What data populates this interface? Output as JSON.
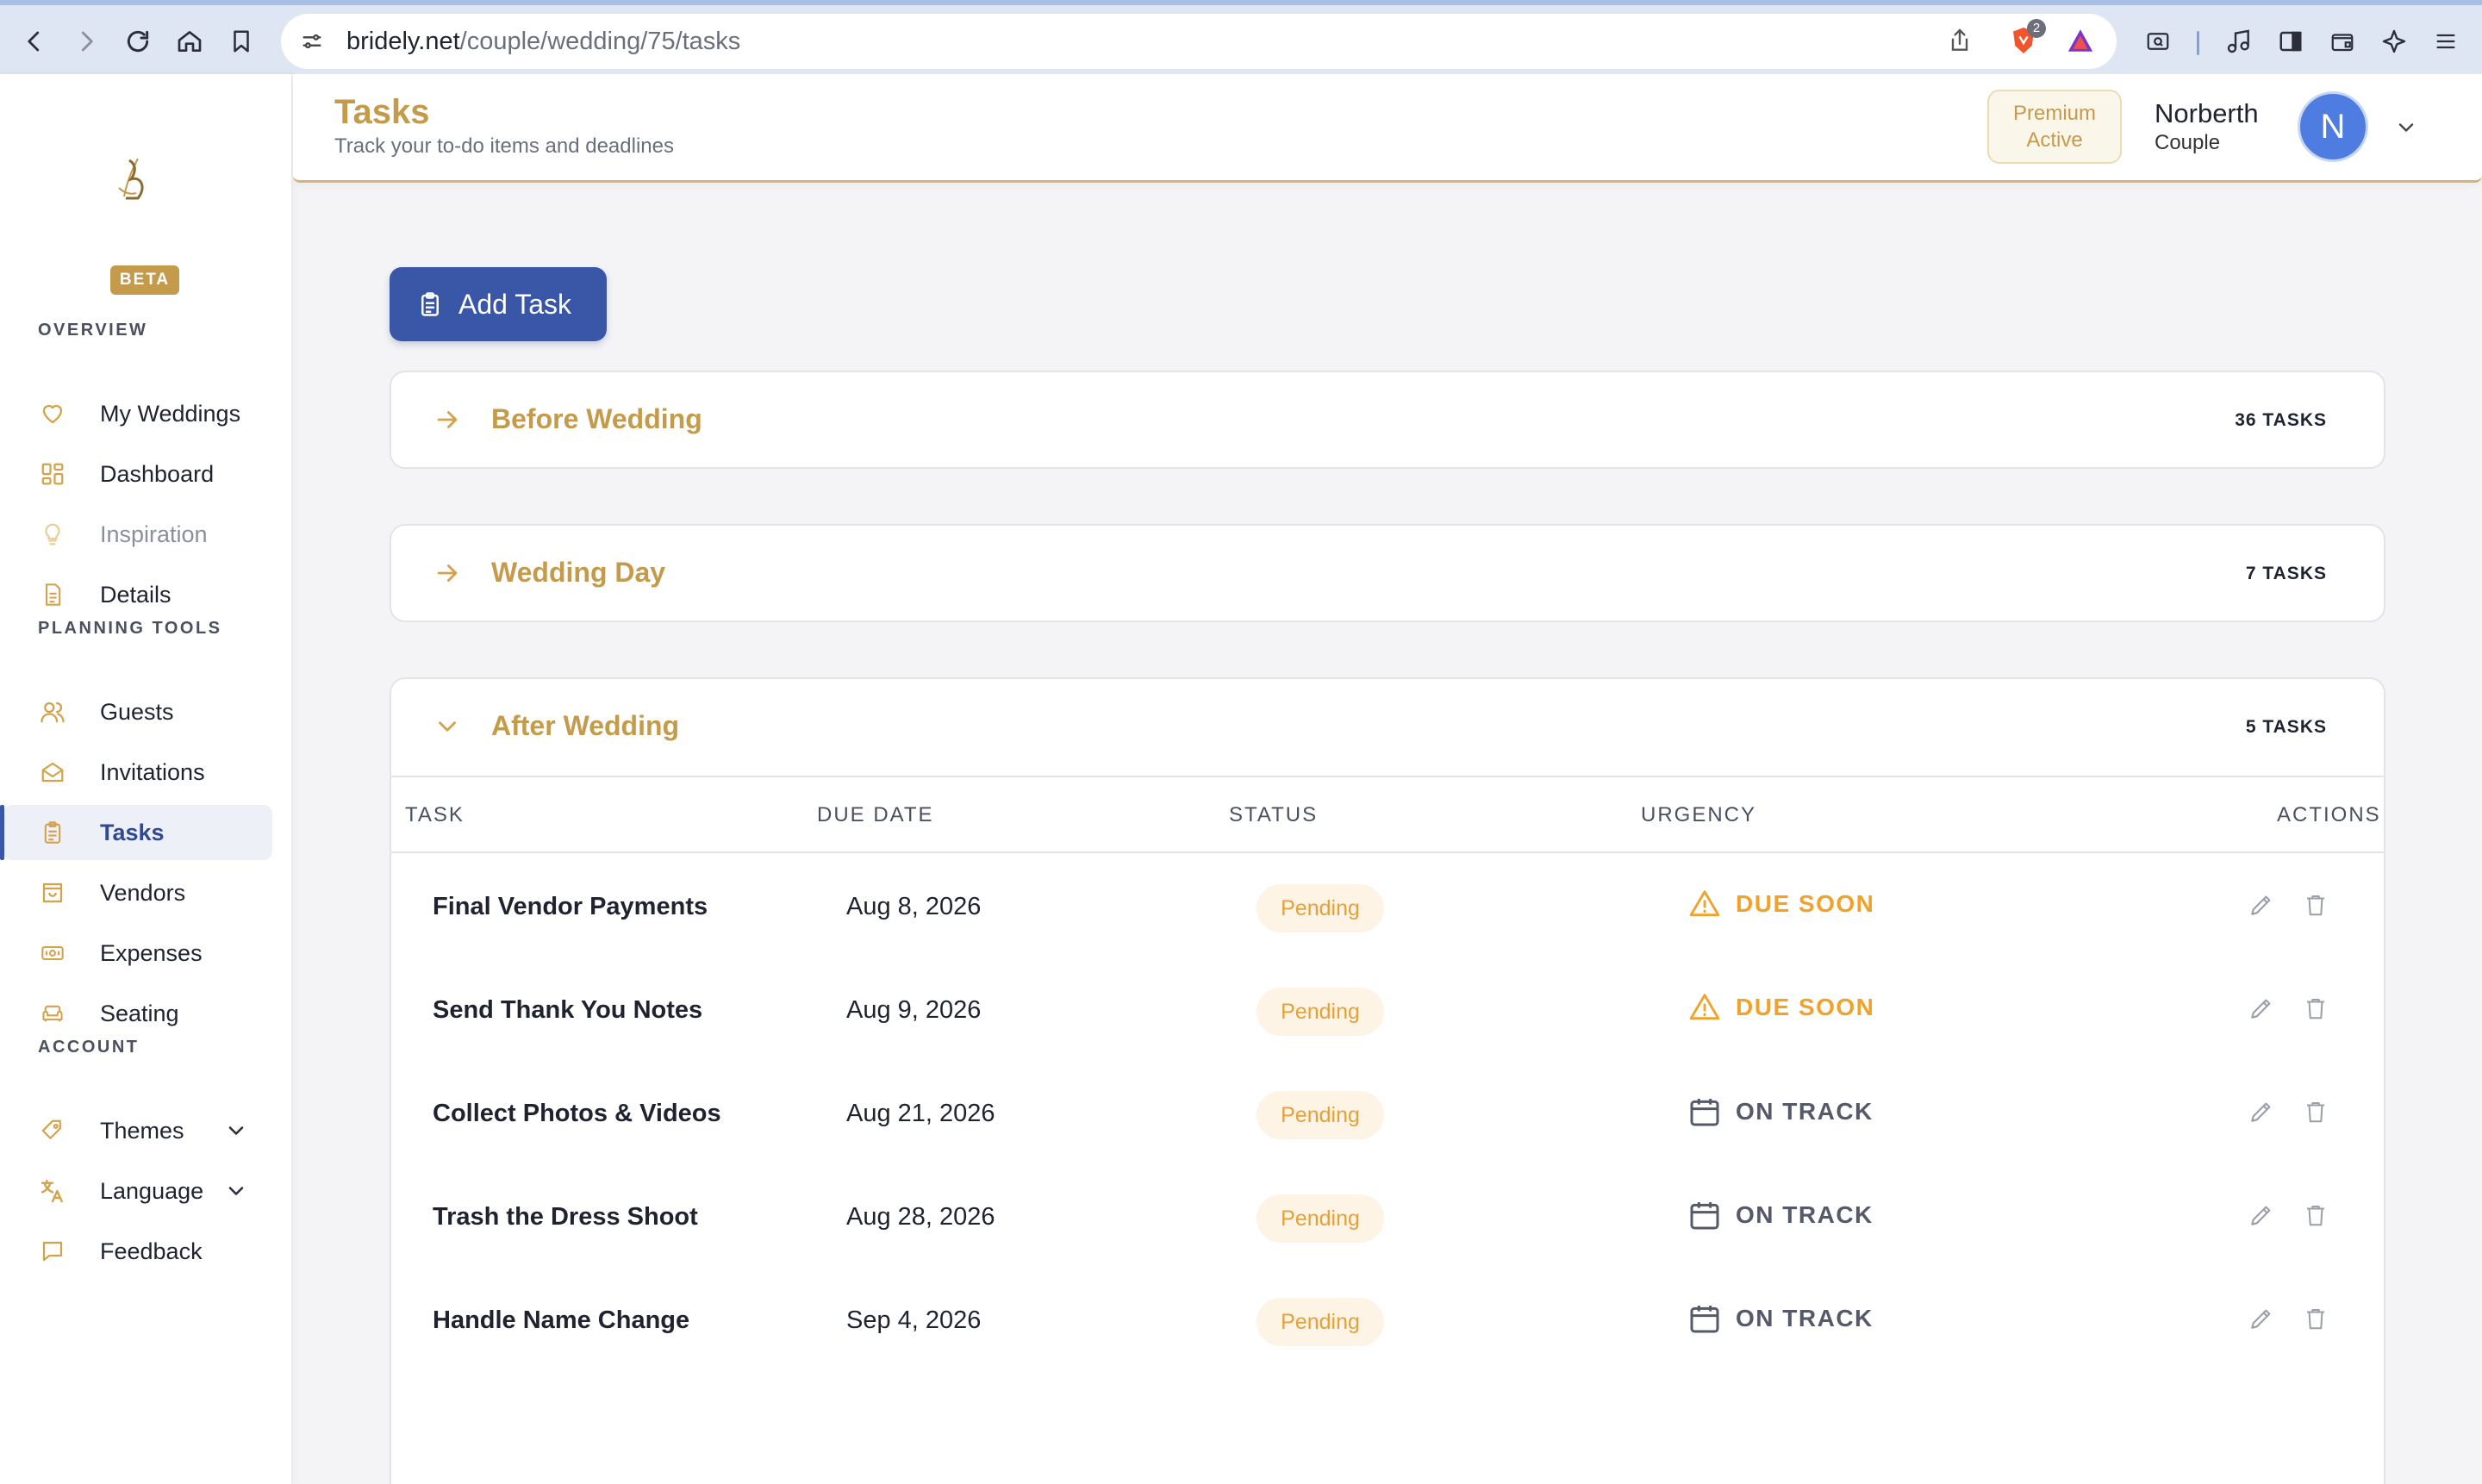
{
  "browser": {
    "url_domain": "bridely.net",
    "url_path": "/couple/wedding/75/tasks",
    "shield_badge": "2"
  },
  "sidebar": {
    "logo": "B",
    "beta": "BETA",
    "sections": {
      "overview": "OVERVIEW",
      "planning": "PLANNING TOOLS",
      "account": "ACCOUNT"
    },
    "items": [
      {
        "label": "My Weddings",
        "icon": "heart-icon"
      },
      {
        "label": "Dashboard",
        "icon": "grid-icon"
      },
      {
        "label": "Inspiration",
        "icon": "lightbulb-icon"
      },
      {
        "label": "Details",
        "icon": "document-icon"
      },
      {
        "label": "Guests",
        "icon": "users-icon"
      },
      {
        "label": "Invitations",
        "icon": "envelope-icon"
      },
      {
        "label": "Tasks",
        "icon": "clipboard-icon"
      },
      {
        "label": "Vendors",
        "icon": "bag-icon"
      },
      {
        "label": "Expenses",
        "icon": "money-icon"
      },
      {
        "label": "Seating",
        "icon": "sofa-icon"
      },
      {
        "label": "Themes",
        "icon": "tag-icon"
      },
      {
        "label": "Language",
        "icon": "translate-icon"
      },
      {
        "label": "Feedback",
        "icon": "chat-icon"
      }
    ]
  },
  "header": {
    "title": "Tasks",
    "subtitle": "Track your to-do items and deadlines",
    "premium_line1": "Premium",
    "premium_line2": "Active",
    "user_name": "Norberth",
    "user_role": "Couple",
    "avatar_initial": "N"
  },
  "main": {
    "add_task_label": "Add Task",
    "groups": [
      {
        "title": "Before Wedding",
        "count": "36 TASKS"
      },
      {
        "title": "Wedding Day",
        "count": "7 TASKS"
      },
      {
        "title": "After Wedding",
        "count": "5 TASKS"
      }
    ],
    "columns": [
      "TASK",
      "DUE DATE",
      "STATUS",
      "URGENCY",
      "ACTIONS"
    ],
    "rows": [
      {
        "task": "Final Vendor Payments",
        "due": "Aug 8, 2026",
        "status": "Pending",
        "urgency": "DUE SOON"
      },
      {
        "task": "Send Thank You Notes",
        "due": "Aug 9, 2026",
        "status": "Pending",
        "urgency": "DUE SOON"
      },
      {
        "task": "Collect Photos & Videos",
        "due": "Aug 21, 2026",
        "status": "Pending",
        "urgency": "ON TRACK"
      },
      {
        "task": "Trash the Dress Shoot",
        "due": "Aug 28, 2026",
        "status": "Pending",
        "urgency": "ON TRACK"
      },
      {
        "task": "Handle Name Change",
        "due": "Sep 4, 2026",
        "status": "Pending",
        "urgency": "ON TRACK"
      }
    ]
  },
  "colors": {
    "gold": "#c49a4b",
    "primary_blue": "#3a56a6",
    "due_soon": "#f0a22a",
    "on_track": "#55596a"
  }
}
